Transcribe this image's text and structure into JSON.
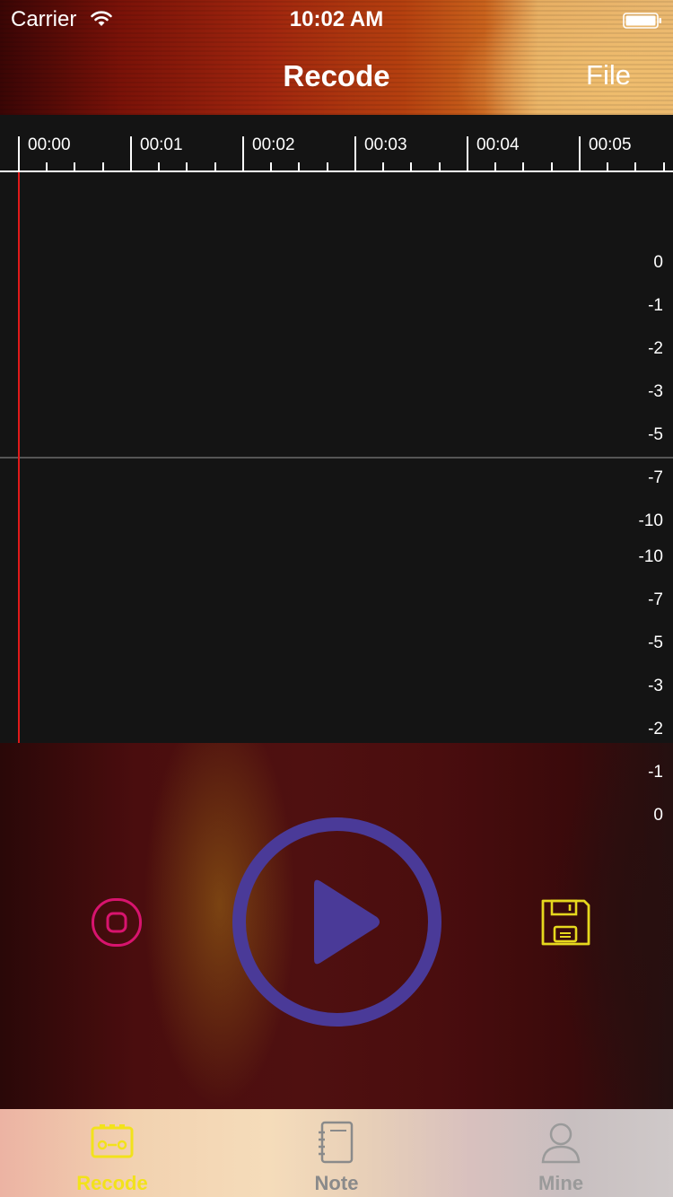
{
  "status_bar": {
    "carrier": "Carrier",
    "time": "10:02 AM"
  },
  "nav": {
    "title": "Recode",
    "right_button": "File"
  },
  "timeline": {
    "labels": [
      "00:00",
      "00:01",
      "00:02",
      "00:03",
      "00:04",
      "00:05"
    ]
  },
  "waveform": {
    "db_scale_top": [
      "0",
      "-1",
      "-2",
      "-3",
      "-5",
      "-7",
      "-10"
    ],
    "db_scale_bottom": [
      "-10",
      "-7",
      "-5",
      "-3",
      "-2",
      "-1",
      "0"
    ]
  },
  "controls": {
    "record_icon": "record-icon",
    "play_icon": "play-icon",
    "save_icon": "save-floppy-icon",
    "colors": {
      "record": "#d8146e",
      "play": "#4a3a98",
      "save": "#e6d81e"
    }
  },
  "tabs": [
    {
      "label": "Recode",
      "icon": "recorder-icon",
      "active": true,
      "color": "#f2e21b"
    },
    {
      "label": "Note",
      "icon": "notebook-icon",
      "active": false,
      "color": "#8a8a8a"
    },
    {
      "label": "Mine",
      "icon": "person-icon",
      "active": false,
      "color": "#9a9a9a"
    }
  ]
}
